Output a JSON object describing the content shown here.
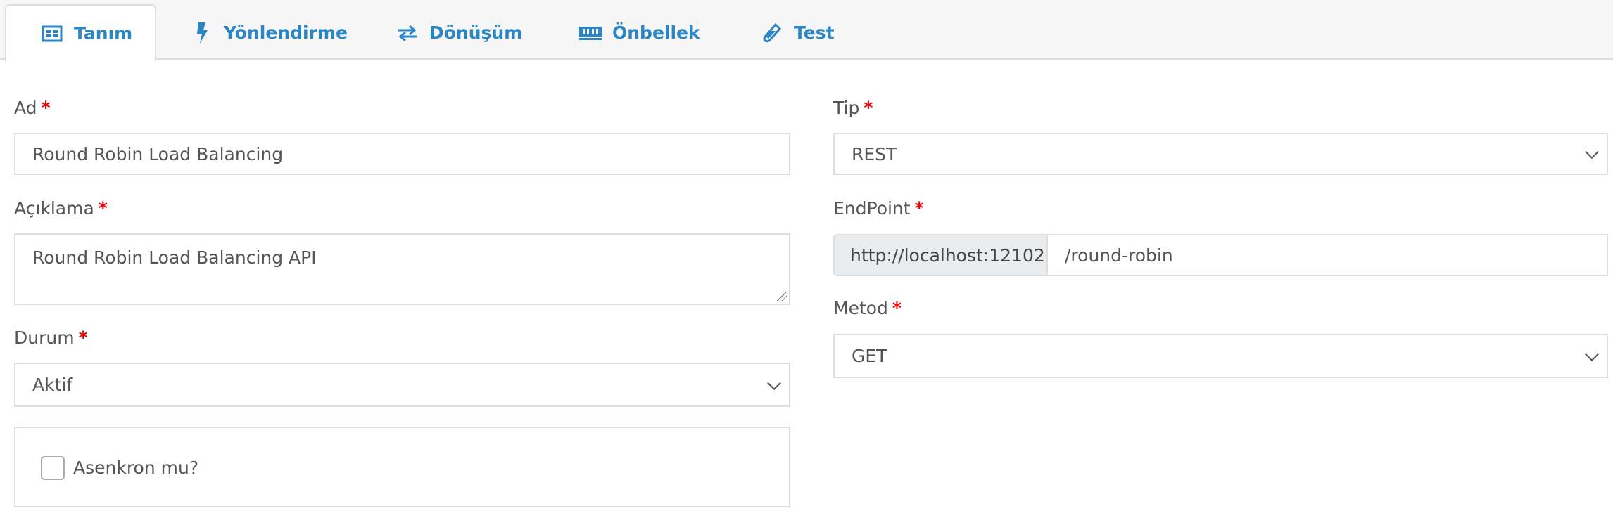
{
  "tabs": [
    {
      "label": "Tanım",
      "icon": "id-card-icon",
      "active": true
    },
    {
      "label": "Yönlendirme",
      "icon": "bolt-icon"
    },
    {
      "label": "Dönüşüm",
      "icon": "exchange-arrows-icon"
    },
    {
      "label": "Önbellek",
      "icon": "memory-icon"
    },
    {
      "label": "Test",
      "icon": "eyedropper-icon"
    }
  ],
  "colors": {
    "accent": "#2a86c5",
    "required": "#ee0000"
  },
  "form": {
    "required_mark": "*",
    "name": {
      "label": "Ad",
      "value": "Round Robin Load Balancing"
    },
    "description": {
      "label": "Açıklama",
      "value": "Round Robin Load Balancing API"
    },
    "status": {
      "label": "Durum",
      "value": "Aktif"
    },
    "async": {
      "label": "Asenkron mu?",
      "checked": false
    },
    "type": {
      "label": "Tip",
      "value": "REST"
    },
    "endpoint": {
      "label": "EndPoint",
      "prefix": "http://localhost:12102",
      "value": "/round-robin"
    },
    "method": {
      "label": "Metod",
      "value": "GET"
    }
  }
}
